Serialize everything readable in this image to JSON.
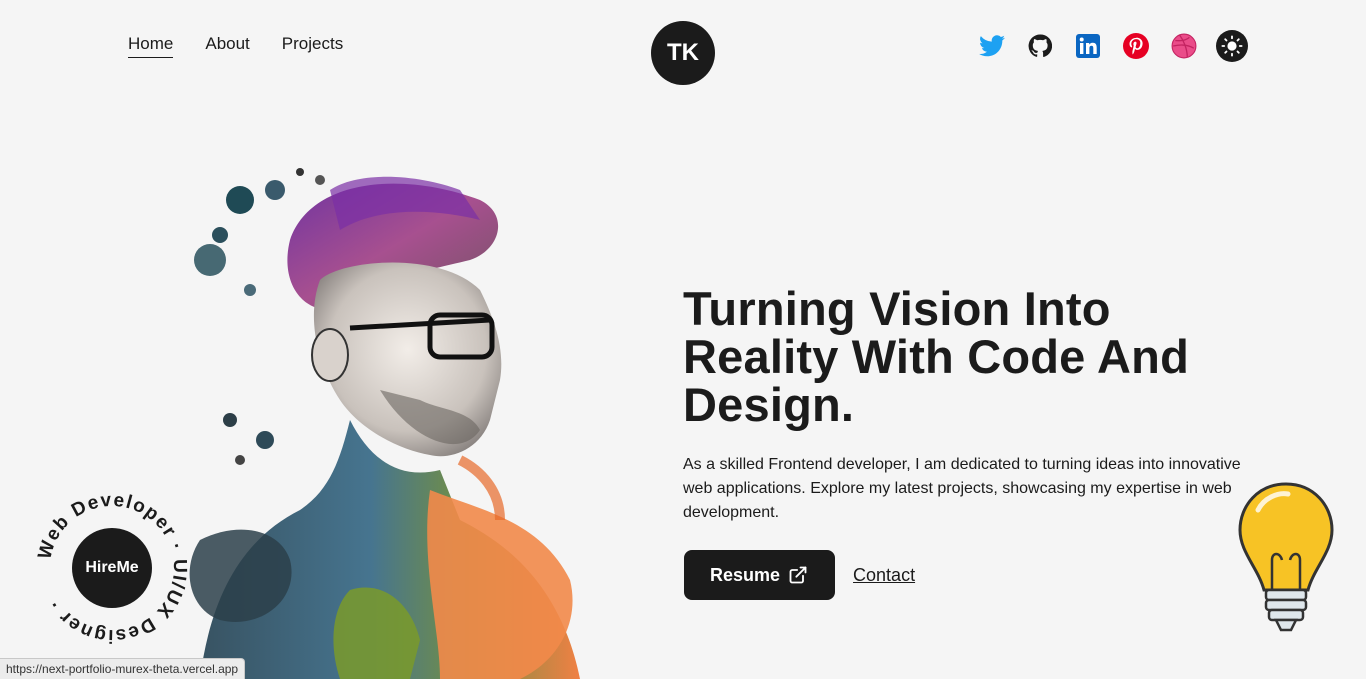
{
  "nav": {
    "links": [
      {
        "label": "Home",
        "active": true
      },
      {
        "label": "About",
        "active": false
      },
      {
        "label": "Projects",
        "active": false
      }
    ],
    "logo": "TK"
  },
  "socials": [
    {
      "name": "twitter-icon",
      "color": "#1da1f2"
    },
    {
      "name": "github-icon",
      "color": "#1b1b1b"
    },
    {
      "name": "linkedin-icon",
      "color": "#0a66c2"
    },
    {
      "name": "pinterest-icon",
      "color": "#e60023"
    },
    {
      "name": "dribbble-icon",
      "color": "#ea4c89"
    },
    {
      "name": "theme-toggle-icon",
      "color": "#1b1b1b"
    }
  ],
  "hero": {
    "headline": "Turning Vision Into Reality With Code And Design.",
    "description": "As a skilled Frontend developer, I am dedicated to turning ideas into innovative web applications. Explore my latest projects, showcasing my expertise in web development.",
    "resume_label": "Resume",
    "contact_label": "Contact"
  },
  "hire": {
    "button_label": "HireMe",
    "ring_text": "Web Developer · UI/UX Designer ·"
  },
  "status_bar": {
    "url": "https://next-portfolio-murex-theta.vercel.app"
  },
  "colors": {
    "background": "#f5f5f5",
    "dark": "#1b1b1b",
    "accent_bulb": "#f7c325"
  }
}
